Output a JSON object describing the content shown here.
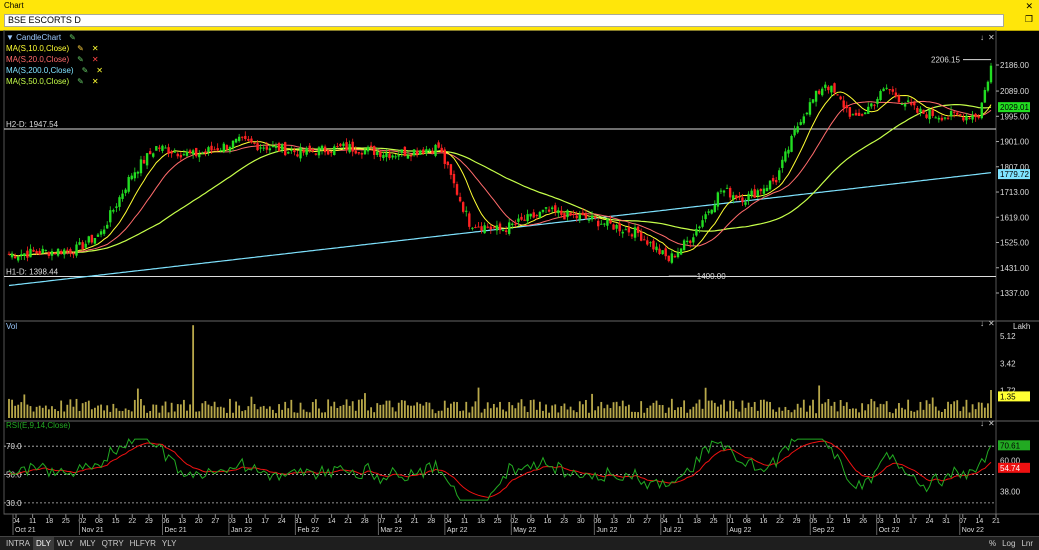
{
  "window": {
    "title": "Chart",
    "symbol_title": "BSE ESCORTS D"
  },
  "price_panel": {
    "indicators": [
      {
        "label": "CandleChart",
        "color": "#9ecbff"
      },
      {
        "label": "MA(S,10.0,Close)",
        "color": "#ffff33"
      },
      {
        "label": "MA(S,20.0,Close)",
        "color": "#ff6b6b"
      },
      {
        "label": "MA(S,200.0,Close)",
        "color": "#7fe3ff"
      },
      {
        "label": "MA(S,50.0,Close)",
        "color": "#c6ff4a"
      }
    ],
    "y_ticks": [
      "2186.00",
      "2089.00",
      "1995.00",
      "1901.00",
      "1807.00",
      "1713.00",
      "1619.00",
      "1525.00",
      "1431.00",
      "1337.00"
    ],
    "tags": {
      "high_line_label": "H2-D: 1947.54",
      "low_line_label": "H1-D: 1398.44",
      "high_annotation": "2206.15",
      "low_annotation": "1400.00",
      "last_price": "2029.01",
      "ma50_tag": "1779.72"
    }
  },
  "volume_panel": {
    "label": "Vol",
    "unit": "Lakh",
    "y_ticks": [
      "5.12",
      "3.42",
      "1.72"
    ],
    "last_value": "1.35"
  },
  "rsi_panel": {
    "label": "RSI(E,9,14,Close)",
    "y_ticks_left": [
      "70.0",
      "50.0",
      "30.0"
    ],
    "y_ticks_right": [
      "60.00",
      "38.00"
    ],
    "rsi_value": "70.61",
    "signal_value": "54.74"
  },
  "x_axis": {
    "days": [
      "04",
      "11",
      "18",
      "25",
      "02",
      "08",
      "15",
      "22",
      "29",
      "06",
      "13",
      "20",
      "27",
      "03",
      "10",
      "17",
      "24",
      "31",
      "07",
      "14",
      "21",
      "28",
      "07",
      "14",
      "21",
      "28",
      "04",
      "11",
      "18",
      "25",
      "02",
      "09",
      "16",
      "23",
      "30",
      "06",
      "13",
      "20",
      "27",
      "04",
      "11",
      "18",
      "25",
      "01",
      "08",
      "16",
      "22",
      "29",
      "05",
      "12",
      "19",
      "26",
      "03",
      "10",
      "17",
      "24",
      "31",
      "07",
      "14",
      "21"
    ],
    "months": [
      "Oct 21",
      "Nov 21",
      "Dec 21",
      "Jan 22",
      "Feb 22",
      "Mar 22",
      "Apr 22",
      "May 22",
      "Jun 22",
      "Jul 22",
      "Aug 22",
      "Sep 22",
      "Oct 22",
      "Nov 22"
    ]
  },
  "bottom_tabs": {
    "items": [
      "INTRA",
      "DLY",
      "WLY",
      "MLY",
      "QTRY",
      "HLFYR",
      "YLY"
    ],
    "selected": "DLY",
    "right_items": [
      "%",
      "Log",
      "Lnr"
    ]
  },
  "colors": {
    "up": "#22dd22",
    "down": "#ff2222",
    "ma10": "#ffff33",
    "ma20": "#ff6b6b",
    "ma50": "#c6ff4a",
    "ma200": "#7fe3ff",
    "volume": "#b8a84a",
    "rsi": "#22aa22",
    "signal": "#ee1111",
    "titlebar": "#ffe60a"
  }
}
